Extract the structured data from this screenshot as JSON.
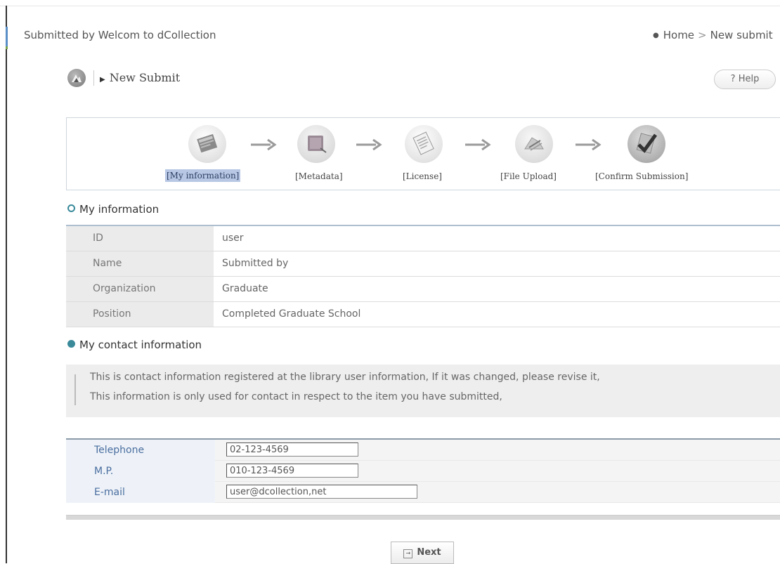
{
  "top_bar": {
    "title": "Submitted by Welcom to dCollection",
    "breadcrumb": [
      "Home",
      "New submit"
    ]
  },
  "header": {
    "title": "New Submit",
    "help_label": "? Help"
  },
  "steps": [
    {
      "label": "[My information]",
      "active": true,
      "icon": "document-icon"
    },
    {
      "label": "[Metadata]",
      "active": false,
      "icon": "metadata-icon"
    },
    {
      "label": "[License]",
      "active": false,
      "icon": "license-icon"
    },
    {
      "label": "[File Upload]",
      "active": false,
      "icon": "file-upload-icon"
    },
    {
      "label": "[Confirm Submission]",
      "active": false,
      "icon": "confirm-check-icon"
    }
  ],
  "my_info": {
    "title": "My information",
    "rows": [
      {
        "label": "ID",
        "value": "user"
      },
      {
        "label": "Name",
        "value": "Submitted by"
      },
      {
        "label": "Organization",
        "value": "Graduate"
      },
      {
        "label": "Position",
        "value": "Completed Graduate School"
      }
    ]
  },
  "contact": {
    "title": "My contact information",
    "notice": [
      "This is contact information registered at the library user information, If it was changed, please revise it,",
      "This information is only used for contact in respect to the item you have submitted,"
    ],
    "fields": [
      {
        "label": "Telephone",
        "value": "02-123-4569"
      },
      {
        "label": "M.P.",
        "value": "010-123-4569"
      },
      {
        "label": "E-mail",
        "value": "user@dcollection,net"
      }
    ]
  },
  "next_label": "Next"
}
